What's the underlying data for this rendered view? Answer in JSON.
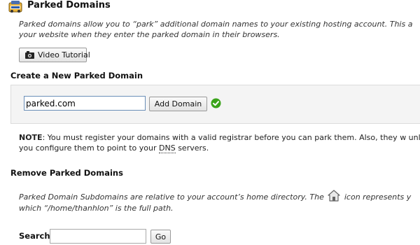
{
  "header": {
    "title": "Parked Domains",
    "icon": "parked-domains-logo-icon"
  },
  "intro": {
    "line1": "Parked domains allow you to “park” additional domain names to your existing hosting account. This a",
    "line2": "your website when they enter the parked domain in their browsers."
  },
  "video_button": {
    "label": "Video Tutorial",
    "icon": "video-camera-icon"
  },
  "create_section": {
    "heading": "Create a New Parked Domain",
    "input_value": "parked.com",
    "add_button_label": "Add Domain",
    "status_icon": "check-circle-icon",
    "status_color": "#3aa31a"
  },
  "note": {
    "label": "NOTE",
    "text_before_dns": ": You must register your domains with a valid registrar before you can park them. Also, they w unless you configure them to point to your ",
    "dns": "DNS",
    "text_after_dns": " servers."
  },
  "remove_section": {
    "heading": "Remove Parked Domains",
    "text_part1": "Parked Domain Subdomains are relative to your account’s home directory. The",
    "home_icon": "home-icon",
    "text_part2": "icon represents y",
    "line2": "which “/home/thanhlon” is the full path."
  },
  "search": {
    "label": "Search",
    "input_value": "",
    "go_label": "Go"
  }
}
